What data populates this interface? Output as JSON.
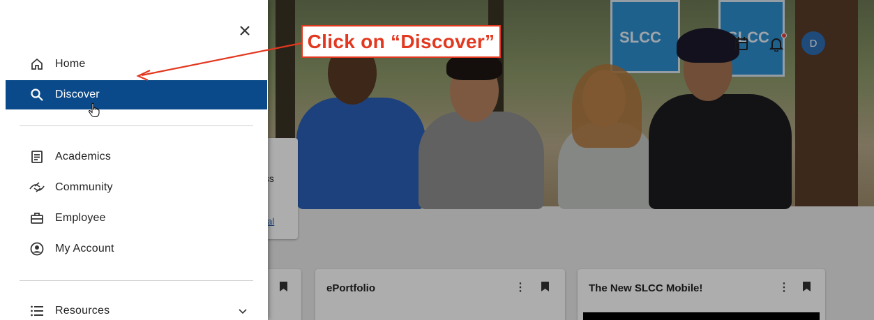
{
  "drawer": {
    "items": [
      {
        "label": "Home",
        "icon": "home-icon",
        "active": false
      },
      {
        "label": "Discover",
        "icon": "search-icon",
        "active": true
      },
      {
        "label": "Academics",
        "icon": "document-icon",
        "active": false
      },
      {
        "label": "Community",
        "icon": "handshake-icon",
        "active": false
      },
      {
        "label": "Employee",
        "icon": "briefcase-icon",
        "active": false
      },
      {
        "label": "My Account",
        "icon": "account-circle-icon",
        "active": false
      },
      {
        "label": "Resources",
        "icon": "list-icon",
        "active": false
      }
    ]
  },
  "hero": {
    "banner_text": "SLCC",
    "avatar_initial": "D"
  },
  "background": {
    "info_card_fragment_1": "niss",
    "info_card_fragment_2": "ortal",
    "cards": [
      {
        "title": ""
      },
      {
        "title": "ePortfolio"
      },
      {
        "title": "The New SLCC Mobile!"
      }
    ],
    "more_glyph": "⋮"
  },
  "annotation": {
    "text": "Click on “Discover”"
  },
  "colors": {
    "active_nav_bg": "#0b4a8a",
    "annotation_red": "#e2381f",
    "avatar_blue": "#2f6fb5"
  }
}
